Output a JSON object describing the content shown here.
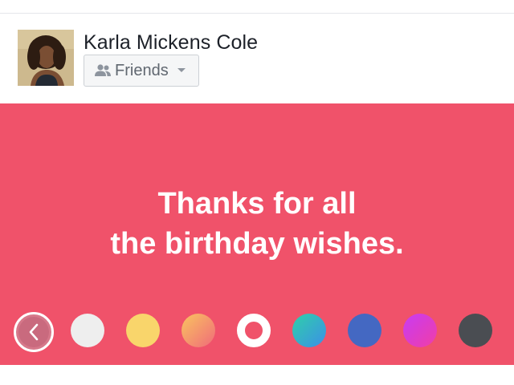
{
  "post_header": {
    "user_name": "Karla Mickens Cole",
    "avatar_icon": "user-photo",
    "audience": {
      "label": "Friends",
      "icon": "friends-icon",
      "dropdown_icon": "chevron-down-icon"
    }
  },
  "composer": {
    "background_color": "#f0526a",
    "text_color": "#ffffff",
    "text_lines": [
      "Thanks for all",
      "the birthday wishes."
    ]
  },
  "background_picker": {
    "back_icon": "chevron-left-icon",
    "selected_index": 4,
    "swatches": [
      {
        "name": "white",
        "fill": "#eeeeee"
      },
      {
        "name": "yellow",
        "fill": "#f9d56b"
      },
      {
        "name": "orange-pink-gradient",
        "fill": "linear-gradient(135deg, #f9c45f, #f06b7a)"
      },
      {
        "name": "selected-current",
        "fill": "#f0526a"
      },
      {
        "name": "teal-green-gradient",
        "fill": "linear-gradient(135deg, #2fd0a8, #3c8fe8)"
      },
      {
        "name": "blue",
        "fill": "#4468c2"
      },
      {
        "name": "purple-magenta-gradient",
        "fill": "linear-gradient(135deg, #c83bf4, #f03ea6)"
      },
      {
        "name": "dark-gray",
        "fill": "#4a4d52"
      }
    ]
  }
}
